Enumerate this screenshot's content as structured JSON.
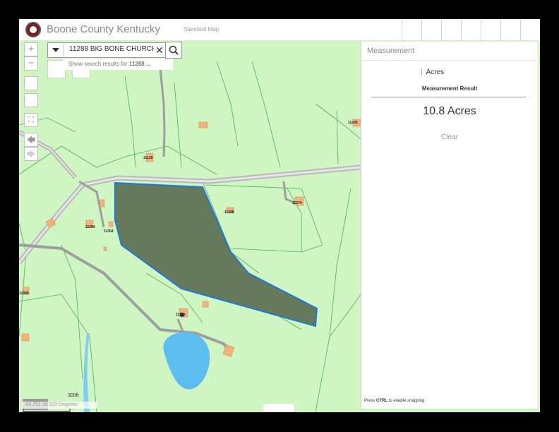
{
  "header": {
    "app_title": "Boone County Kentucky",
    "map_subtitle": "Standard Map"
  },
  "search": {
    "query": "11288 BIG BONE CHURCH",
    "results_hint_prefix": "Show search results for ",
    "results_hint_term": "11288 ...",
    "clear_glyph": "✕"
  },
  "map_controls": {
    "zoom_in": "+",
    "zoom_out": "−",
    "back": "🡄",
    "forward": "🡆"
  },
  "parcel_labels": [
    "11130",
    "11288",
    "11274",
    "11284",
    "11304",
    "11243",
    "11389",
    "11300"
  ],
  "scale": {
    "label": "300ft"
  },
  "coordinates": "-84.751 38.920 Degrees",
  "measurement_panel": {
    "title": "Measurement",
    "unit_label": "Acres",
    "result_heading": "Measurement Result",
    "result_value": "10.8 Acres",
    "clear_label": "Clear",
    "snap_hint_prefix": "Press ",
    "snap_hint_key": "CTRL",
    "snap_hint_suffix": " to enable snapping"
  },
  "colors": {
    "map_background": "#cff5c2",
    "selected_parcel_fill": "#657a5b",
    "selected_parcel_outline": "#1e78d6",
    "building": "#f3b27a",
    "parcel_lines": "#4caf50",
    "pond": "#5bbdf0"
  }
}
